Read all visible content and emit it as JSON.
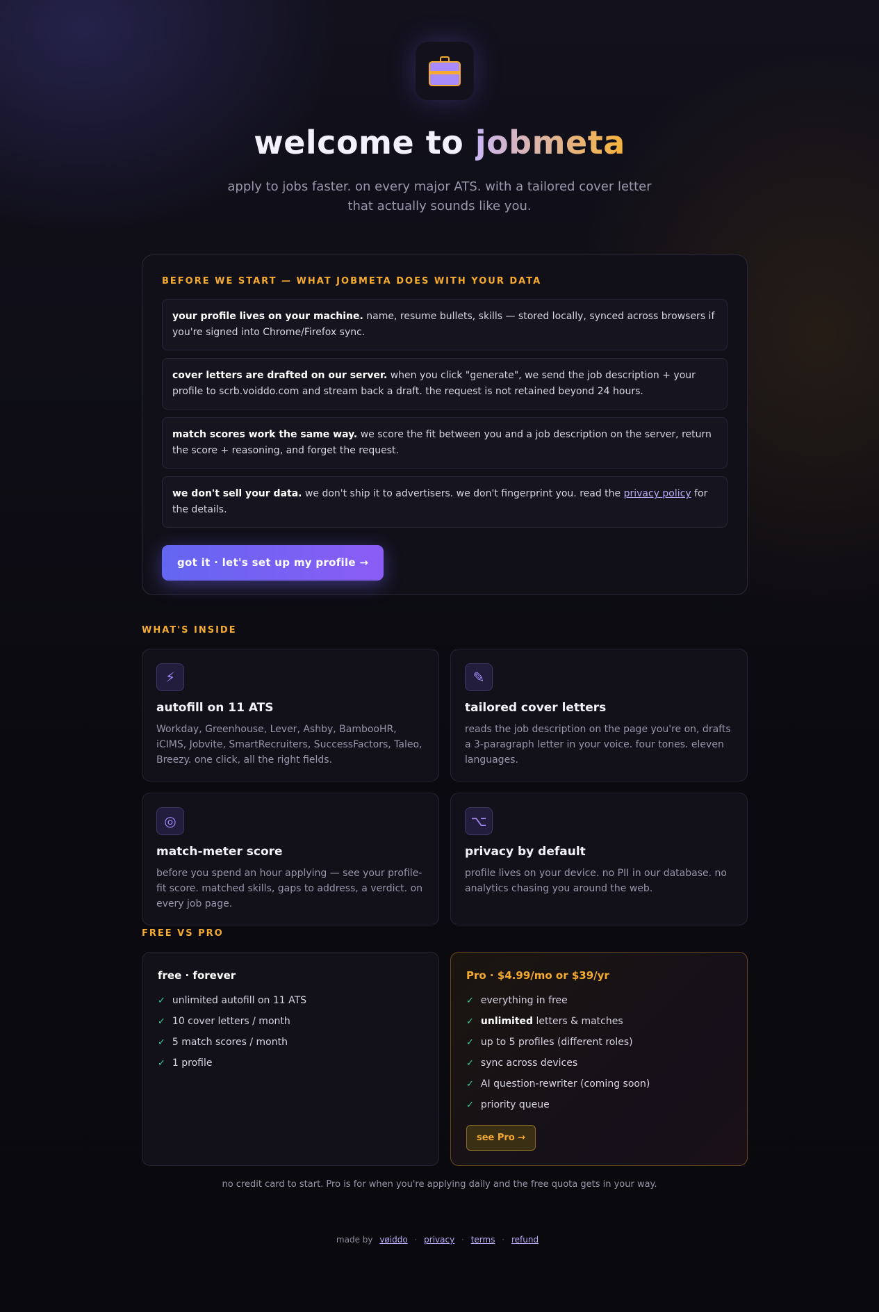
{
  "hero": {
    "title_prefix": "welcome to ",
    "title_brand": "jobmeta",
    "subtitle": "apply to jobs faster. on every major ATS. with a tailored cover letter that actually sounds like you.",
    "logo_icon": "briefcase-icon"
  },
  "data_card": {
    "eyebrow": "BEFORE WE START — WHAT JOBMETA DOES WITH YOUR DATA",
    "notes": [
      {
        "lead": "your profile lives on your machine.",
        "body": " name, resume bullets, skills — stored locally, synced across browsers if you're signed into Chrome/Firefox sync."
      },
      {
        "lead": "cover letters are drafted on our server.",
        "body": " when you click \"generate\", we send the job description + your profile to scrb.voiddo.com and stream back a draft. the request is not retained beyond 24 hours."
      },
      {
        "lead": "match scores work the same way.",
        "body": " we score the fit between you and a job description on the server, return the score + reasoning, and forget the request."
      },
      {
        "lead": "we don't sell your data.",
        "body": " we don't ship it to advertisers. we don't fingerprint you. read the ",
        "link": "privacy policy",
        "tail": " for the details."
      }
    ],
    "cta_label": "got it · let's set up my profile →"
  },
  "inside": {
    "label": "WHAT'S INSIDE",
    "features": [
      {
        "icon": "lightning-icon",
        "glyph": "⚡",
        "title": "autofill on 11 ATS",
        "desc": "Workday, Greenhouse, Lever, Ashby, BambooHR, iCIMS, Jobvite, SmartRecruiters, SuccessFactors, Taleo, Breezy. one click, all the right fields."
      },
      {
        "icon": "pencil-icon",
        "glyph": "✎",
        "title": "tailored cover letters",
        "desc": "reads the job description on the page you're on, drafts a 3-paragraph letter in your voice. four tones. eleven languages."
      },
      {
        "icon": "target-icon",
        "glyph": "◎",
        "title": "match-meter score",
        "desc": "before you spend an hour applying — see your profile-fit score. matched skills, gaps to address, a verdict. on every job page."
      },
      {
        "icon": "option-key-icon",
        "glyph": "⌥",
        "title": "privacy by default",
        "desc": "profile lives on your device. no PII in our database. no analytics chasing you around the web."
      }
    ]
  },
  "plans": {
    "label": "FREE VS PRO",
    "free": {
      "title": "free · forever",
      "items": [
        "unlimited autofill on 11 ATS",
        "10 cover letters / month",
        "5 match scores / month",
        "1 profile"
      ]
    },
    "pro": {
      "title": "Pro · $4.99/mo or $39/yr",
      "items": [
        "everything in free",
        "letters & matches",
        "up to 5 profiles (different roles)",
        "sync across devices",
        "AI question-rewriter (coming soon)",
        "priority queue"
      ],
      "unlimited_word": "unlimited",
      "button": "see Pro →"
    },
    "check_glyph": "✓",
    "fine_print": "no credit card to start. Pro is for when you're applying daily and the free quota gets in your way."
  },
  "footer": {
    "made_by": "made by",
    "brand_link": "vøiddo",
    "links": [
      "privacy",
      "terms",
      "refund"
    ],
    "sep": "·"
  },
  "colors": {
    "accent_gold": "#f5ab2f",
    "accent_violet": "#8b5cf6",
    "check_green": "#34d399",
    "background": "#0c0b12"
  }
}
